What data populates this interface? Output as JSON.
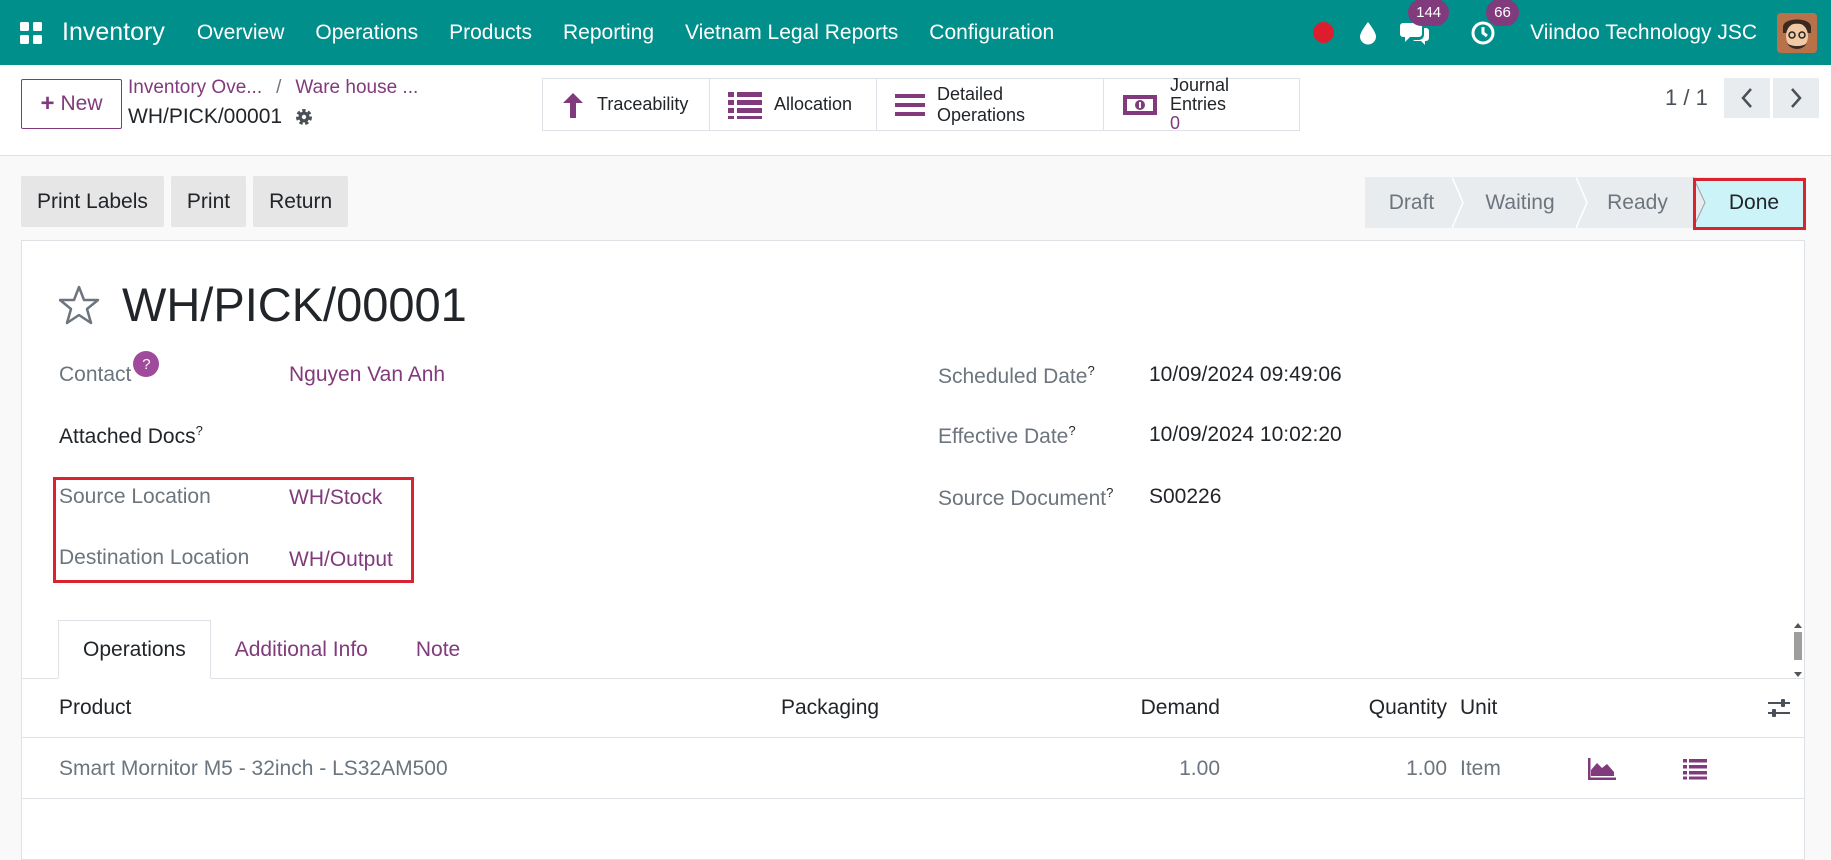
{
  "topbar": {
    "app_name": "Inventory",
    "nav": [
      "Overview",
      "Operations",
      "Products",
      "Reporting",
      "Vietnam Legal Reports",
      "Configuration"
    ],
    "messages_count": "144",
    "activities_count": "66",
    "company": "Viindoo Technology JSC"
  },
  "control": {
    "new_label": "New",
    "breadcrumb": [
      "Inventory Ove...",
      "Ware house ..."
    ],
    "breadcrumb_sep": "/",
    "current": "WH/PICK/00001",
    "smart_buttons": {
      "traceability": "Traceability",
      "allocation": "Allocation",
      "detailed_operations": "Detailed Operations",
      "journal_entries_label": "Journal Entries",
      "journal_entries_value": "0"
    },
    "pager": "1 / 1"
  },
  "actions": {
    "print_labels": "Print Labels",
    "print": "Print",
    "return": "Return"
  },
  "status": {
    "steps": [
      "Draft",
      "Waiting",
      "Ready",
      "Done"
    ],
    "active": "Done"
  },
  "form": {
    "title": "WH/PICK/00001",
    "contact_label": "Contact",
    "contact_help": "?",
    "contact_value": "Nguyen Van Anh",
    "attached_docs_label": "Attached Docs",
    "source_location_label": "Source Location",
    "source_location_value": "WH/Stock",
    "destination_location_label": "Destination Location",
    "destination_location_value": "WH/Output",
    "scheduled_date_label": "Scheduled Date",
    "scheduled_date_value": "10/09/2024 09:49:06",
    "effective_date_label": "Effective Date",
    "effective_date_value": "10/09/2024 10:02:20",
    "source_document_label": "Source Document",
    "source_document_value": "S00226",
    "help_mark": "?"
  },
  "tabs": [
    "Operations",
    "Additional Info",
    "Note"
  ],
  "table": {
    "headers": {
      "product": "Product",
      "packaging": "Packaging",
      "demand": "Demand",
      "quantity": "Quantity",
      "unit": "Unit"
    },
    "rows": [
      {
        "product": "Smart Mornitor M5 - 32inch - LS32AM500",
        "packaging": "",
        "demand": "1.00",
        "quantity": "1.00",
        "unit": "Item"
      }
    ]
  }
}
